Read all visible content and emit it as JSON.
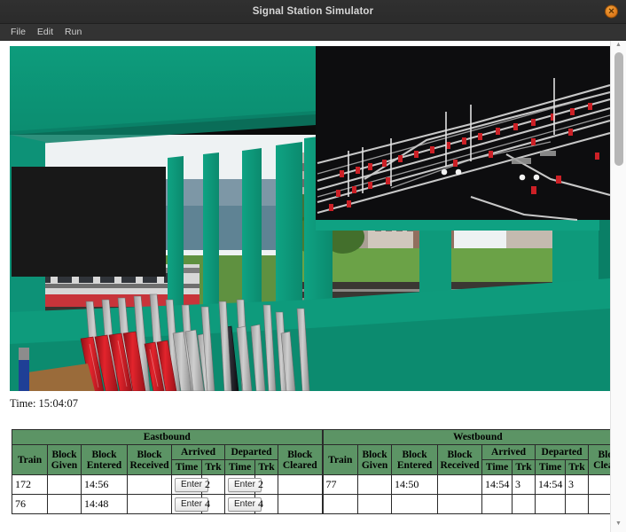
{
  "window": {
    "title": "Signal Station Simulator",
    "close_icon": "close-icon",
    "close_glyph": "✕"
  },
  "menubar": {
    "items": [
      {
        "label": "File"
      },
      {
        "label": "Edit"
      },
      {
        "label": "Run"
      }
    ]
  },
  "scene": {
    "description": "3D signal box interior view with lever frame, windows and track diagram board",
    "colors": {
      "interior_teal": "#0e9e7e",
      "ceiling_teal": "#0c8f73",
      "diagram_black": "#0d0d0d",
      "lever_red": "#cc1a22",
      "lever_grey": "#b5b5b5",
      "lever_black": "#15151a",
      "floor_brown": "#9a6b3a",
      "sky_white": "#f3f5f6",
      "grass_green": "#5b8f3a",
      "track_dark": "#2a2724",
      "signal_red": "#c9262a"
    }
  },
  "status": {
    "time_label": "Time: 15:04:07"
  },
  "table": {
    "directions": [
      {
        "name": "Eastbound"
      },
      {
        "name": "Westbound"
      }
    ],
    "columns": [
      "Train",
      "Block Given",
      "Block Entered",
      "Block Received",
      "Arrived",
      "Departed",
      "Block Cleared"
    ],
    "headers": {
      "train": "Train",
      "block_given_1": "Block",
      "block_given_2": "Given",
      "block_entered_1": "Block",
      "block_entered_2": "Entered",
      "block_received_1": "Block",
      "block_received_2": "Received",
      "arrived": "Arrived",
      "departed": "Departed",
      "time": "Time",
      "trk": "Trk",
      "block_cleared_1": "Block",
      "block_cleared_2": "Cleared"
    },
    "enter_button_label": "Enter",
    "eastbound_rows": [
      {
        "train": "172",
        "block_given": "",
        "block_entered": "14:56",
        "block_received": "",
        "arrived_time": "Enter",
        "arrived_trk": "2",
        "departed_time": "Enter",
        "departed_trk": "2",
        "block_cleared": ""
      },
      {
        "train": "76",
        "block_given": "",
        "block_entered": "14:48",
        "block_received": "",
        "arrived_time": "Enter",
        "arrived_trk": "4",
        "departed_time": "Enter",
        "departed_trk": "4",
        "block_cleared": ""
      }
    ],
    "westbound_rows": [
      {
        "train": "77",
        "block_given": "",
        "block_entered": "14:50",
        "block_received": "",
        "arrived_time": "14:54",
        "arrived_trk": "3",
        "departed_time": "14:54",
        "departed_trk": "3",
        "block_cleared": ""
      },
      {
        "train": "",
        "block_given": "",
        "block_entered": "",
        "block_received": "",
        "arrived_time": "",
        "arrived_trk": "",
        "departed_time": "",
        "departed_trk": "",
        "block_cleared": ""
      }
    ]
  },
  "scrollbar": {
    "up_glyph": "▲",
    "down_glyph": "▼"
  },
  "colors": {
    "titlebar": "#2e2e2e",
    "menubar": "#333333",
    "header_green": "#5c9465",
    "close_orange": "#e07c1c"
  }
}
